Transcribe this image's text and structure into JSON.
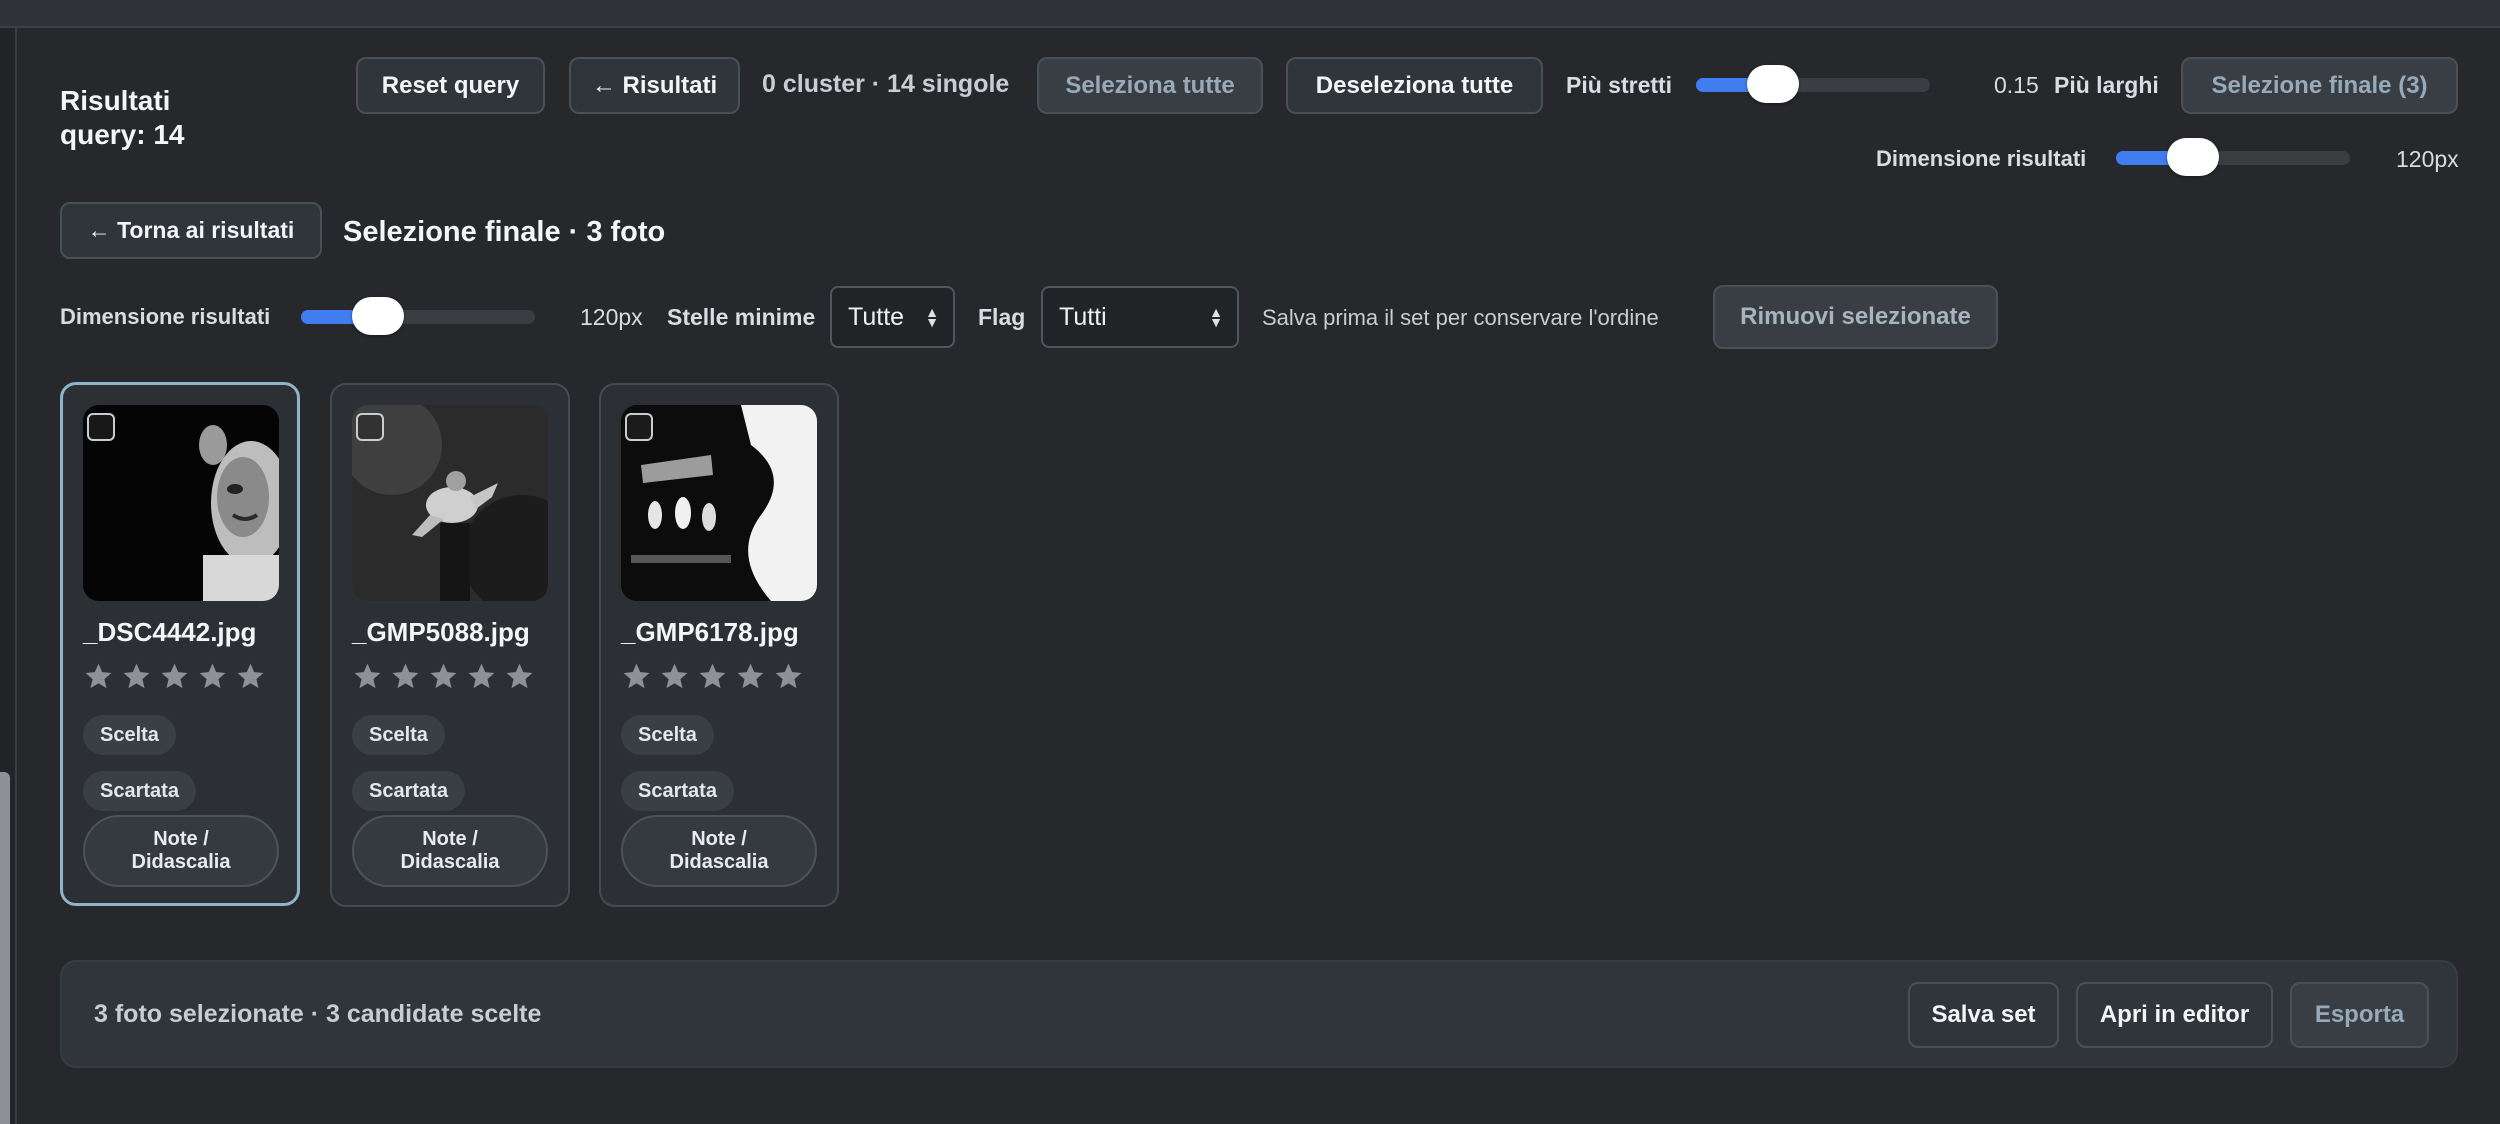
{
  "header": {
    "results_title": "Risultati query: 14",
    "reset_label": "Reset query",
    "back_results_label": "← Risultati",
    "cluster_summary": "0 cluster · 14 singole",
    "select_all_label": "Seleziona tutte",
    "deselect_all_label": "Deseleziona tutte",
    "tighter_label": "Più stretti",
    "threshold_value": "0.15",
    "threshold_fraction": 0.33,
    "looser_label": "Più larghi",
    "final_selection_label": "Selezione finale (3)",
    "result_size_label": "Dimensione risultati",
    "result_size_value": "120px",
    "result_size_fraction": 0.33
  },
  "final_view": {
    "back_label": "← Torna ai risultati",
    "title": "Selezione finale · 3 foto"
  },
  "filters": {
    "size_label": "Dimensione risultati",
    "size_value": "120px",
    "size_fraction": 0.33,
    "stars_label": "Stelle minime",
    "stars_selected": "Tutte",
    "flag_label": "Flag",
    "flag_selected": "Tutti",
    "hint": "Salva prima il set per conservare l'ordine",
    "remove_label": "Rimuovi selezionate"
  },
  "photos": [
    {
      "filename": "_DSC4442.jpg",
      "rating": 0,
      "selected_card": true,
      "checked": false,
      "chip_pick": "Scelta",
      "chip_reject": "Scartata",
      "note_line1": "Note /",
      "note_line2": "Didascalia"
    },
    {
      "filename": "_GMP5088.jpg",
      "rating": 0,
      "selected_card": false,
      "checked": false,
      "chip_pick": "Scelta",
      "chip_reject": "Scartata",
      "note_line1": "Note /",
      "note_line2": "Didascalia"
    },
    {
      "filename": "_GMP6178.jpg",
      "rating": 0,
      "selected_card": false,
      "checked": false,
      "chip_pick": "Scelta",
      "chip_reject": "Scartata",
      "note_line1": "Note /",
      "note_line2": "Didascalia"
    }
  ],
  "footer": {
    "summary": "3 foto selezionate · 3 candidate scelte",
    "save_set_label": "Salva set",
    "open_editor_label": "Apri in editor",
    "export_label": "Esporta"
  },
  "colors": {
    "background": "#26282b",
    "accent": "#3f7df0",
    "selected_border": "#8fb3c9",
    "muted_button_text": "#98aab9"
  }
}
